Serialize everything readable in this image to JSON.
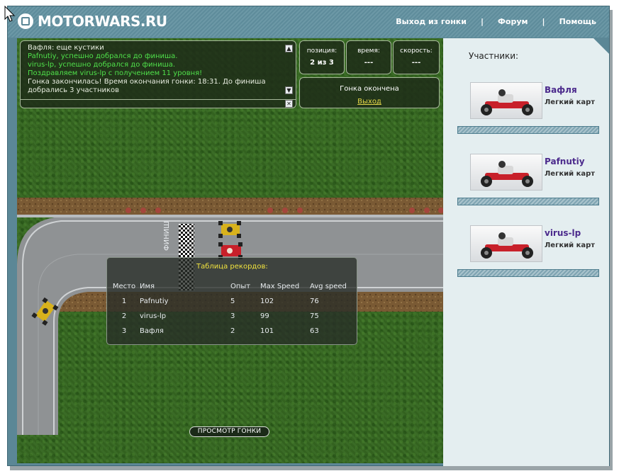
{
  "header": {
    "logo_text": "MOTORWARS.RU",
    "nav": [
      {
        "label": "Выход из гонки"
      },
      {
        "label": "Форум"
      },
      {
        "label": "Помощь"
      }
    ],
    "separator": "|"
  },
  "chat": {
    "lines": [
      {
        "text": "Вафля: еще кустики",
        "color": "white"
      },
      {
        "text": "Pafnutiy, успешно добрался до финиша.",
        "color": "green"
      },
      {
        "text": "virus-lp, успешно добрался до финиша.",
        "color": "green"
      },
      {
        "text": "Поздравляем virus-lp с получением 11 уровня!",
        "color": "green"
      },
      {
        "text": "Гонка закончилась! Время окончания гонки: 18:31. До финиша",
        "color": "white"
      },
      {
        "text": "добрались 3 участников",
        "color": "white"
      }
    ],
    "up_glyph": "▲",
    "down_glyph": "▼",
    "close_glyph": "✕"
  },
  "stats": {
    "position_label": "позиция:",
    "position_value": "2 из 3",
    "time_label": "время:",
    "time_value": "---",
    "speed_label": "скорость:",
    "speed_value": "---"
  },
  "race": {
    "status": "Гонка окончена",
    "exit_link": "Выход"
  },
  "records": {
    "title": "Таблица рекордов:",
    "columns": [
      "Место",
      "Имя",
      "Опыт",
      "Max Speed",
      "Avg speed"
    ],
    "rows": [
      [
        "1",
        "Pafnutiy",
        "5",
        "102",
        "76"
      ],
      [
        "2",
        "virus-lp",
        "3",
        "99",
        "75"
      ],
      [
        "3",
        "Вафля",
        "2",
        "101",
        "63"
      ]
    ]
  },
  "replay_button": "ПРОСМОТР ГОНКИ",
  "sidebar": {
    "title": "Участники:",
    "participants": [
      {
        "name": "Вафля",
        "kart": "Легкий карт"
      },
      {
        "name": "Pafnutiy",
        "kart": "Легкий карт"
      },
      {
        "name": "virus-lp",
        "kart": "Легкий карт"
      }
    ]
  },
  "track": {
    "finish_text": "ФИНИШ"
  },
  "colors": {
    "header_bg": "#5b8796",
    "grass": "#3a6b26",
    "chat_green": "#4fe04a",
    "records_title": "#f0e23e",
    "participant_name": "#4b2a8c",
    "kart_red": "#c8202a"
  }
}
